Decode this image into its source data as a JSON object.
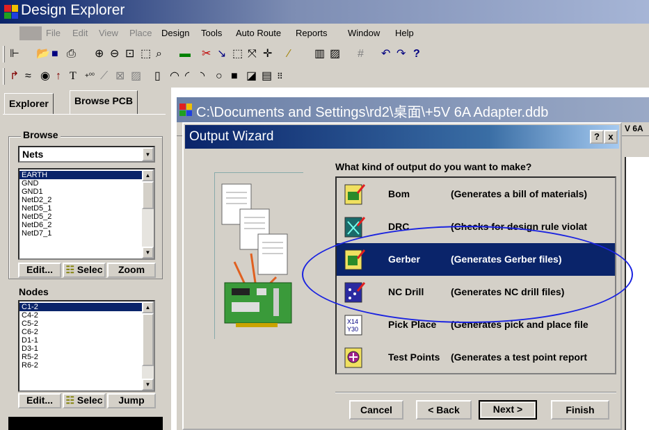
{
  "app": {
    "title": "Design Explorer"
  },
  "menu": [
    "File",
    "Edit",
    "View",
    "Place",
    "Design",
    "Tools",
    "Auto Route",
    "Reports",
    "Window",
    "Help"
  ],
  "toolbar1": [
    "folder-tree-icon",
    "open-icon",
    "save-icon",
    "print-icon",
    "zoom-in-icon",
    "zoom-out-icon",
    "zoom-fit-icon",
    "zoom-area-icon",
    "zoom-region-icon",
    "highlight-icon",
    "cut-icon",
    "line-icon",
    "select-icon",
    "move-icon",
    "cross-icon",
    "probe-icon",
    "library-icon",
    "browse-lib-icon",
    "grid-icon",
    "undo-icon",
    "redo-icon",
    "help-icon"
  ],
  "left": {
    "tabs": [
      "Explorer",
      "Browse PCB"
    ],
    "browse_label": "Browse",
    "browse_value": "Nets",
    "nets": [
      "EARTH",
      "GND",
      "GND1",
      "NetD2_2",
      "NetD5_1",
      "NetD5_2",
      "NetD6_2",
      "NetD7_1"
    ],
    "nets_btn": [
      "Edit...",
      "Selec",
      "Zoom"
    ],
    "nodes_label": "Nodes",
    "nodes": [
      "C1-2",
      "C4-2",
      "C5-2",
      "C6-2",
      "D1-1",
      "D3-1",
      "R5-2",
      "R6-2"
    ],
    "nodes_btn": [
      "Edit...",
      "Selec",
      "Jump"
    ]
  },
  "doc": {
    "title": "C:\\Documents and Settings\\rd2\\桌面\\+5V 6A Adapter.ddb",
    "side_text": "V 6A"
  },
  "wizard": {
    "title": "Output Wizard",
    "help_btn": "?",
    "close_btn": "x",
    "question": "What kind of output do you want to make?",
    "items": [
      {
        "name": "Bom",
        "desc": "(Generates a bill of materials)"
      },
      {
        "name": "DRC",
        "desc": "(Checks for design rule violat"
      },
      {
        "name": "Gerber",
        "desc": "(Generates Gerber files)"
      },
      {
        "name": "NC Drill",
        "desc": "(Generates NC drill files)"
      },
      {
        "name": "Pick Place",
        "desc": "(Generates pick and place file"
      },
      {
        "name": "Test Points",
        "desc": "(Generates a test point report"
      }
    ],
    "selected": "Gerber",
    "buttons": {
      "cancel": "Cancel",
      "back": "< Back",
      "next": "Next >",
      "finish": "Finish"
    }
  },
  "colors": {
    "title_active": "#0a246a",
    "face": "#d4d0c8",
    "annotation": "#1a23e0"
  }
}
